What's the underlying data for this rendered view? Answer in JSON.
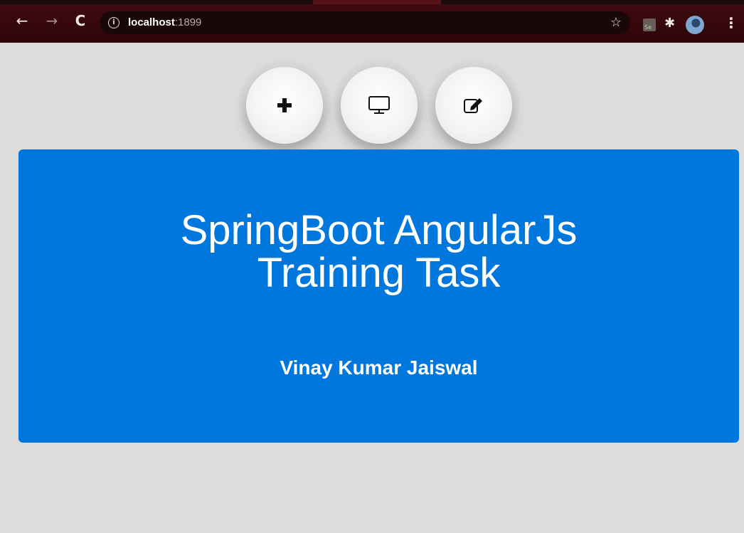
{
  "browser": {
    "url_host": "localhost",
    "url_port": ":1899",
    "extension_label": "Se",
    "icons": {
      "back": "back-arrow-icon",
      "forward": "forward-arrow-icon",
      "reload": "reload-icon",
      "info": "info-icon",
      "bookmark": "star-icon",
      "extensions": "puzzle-icon",
      "menu": "kebab-menu-icon"
    }
  },
  "toolbar": {
    "buttons": [
      {
        "icon": "plus-icon"
      },
      {
        "icon": "monitor-icon"
      },
      {
        "icon": "edit-icon"
      }
    ]
  },
  "jumbotron": {
    "title_line1": "SpringBoot AngularJs",
    "title_line2": "Training Task",
    "author": "Vinay Kumar Jaiswal",
    "background_color": "#0077dd"
  }
}
